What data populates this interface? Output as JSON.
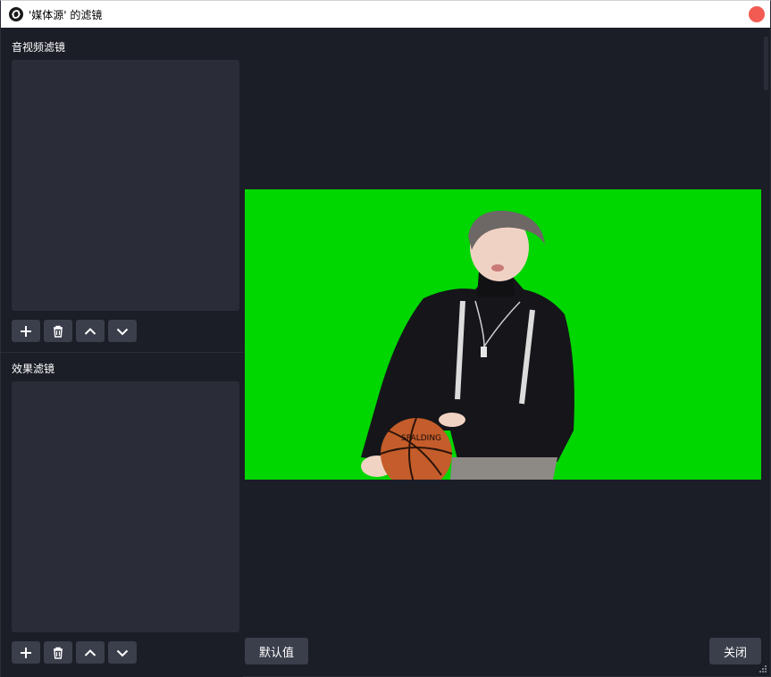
{
  "window": {
    "title": "'媒体源' 的滤镜"
  },
  "audio_video_filters": {
    "label": "音视频滤镜",
    "items": []
  },
  "effect_filters": {
    "label": "效果滤镜",
    "items": []
  },
  "toolbar_icons": [
    "add-icon",
    "trash-icon",
    "chevron-up-icon",
    "chevron-down-icon"
  ],
  "buttons": {
    "defaults": "默认值",
    "close": "关闭"
  },
  "preview": {
    "ball_text": "SPALDING",
    "colors": {
      "background": "#1b1d27",
      "chroma_green": "#00d600"
    }
  },
  "colors": {
    "close_dot": "#f25b52",
    "panel": "#2a2c38",
    "button": "#3b3e4b"
  }
}
